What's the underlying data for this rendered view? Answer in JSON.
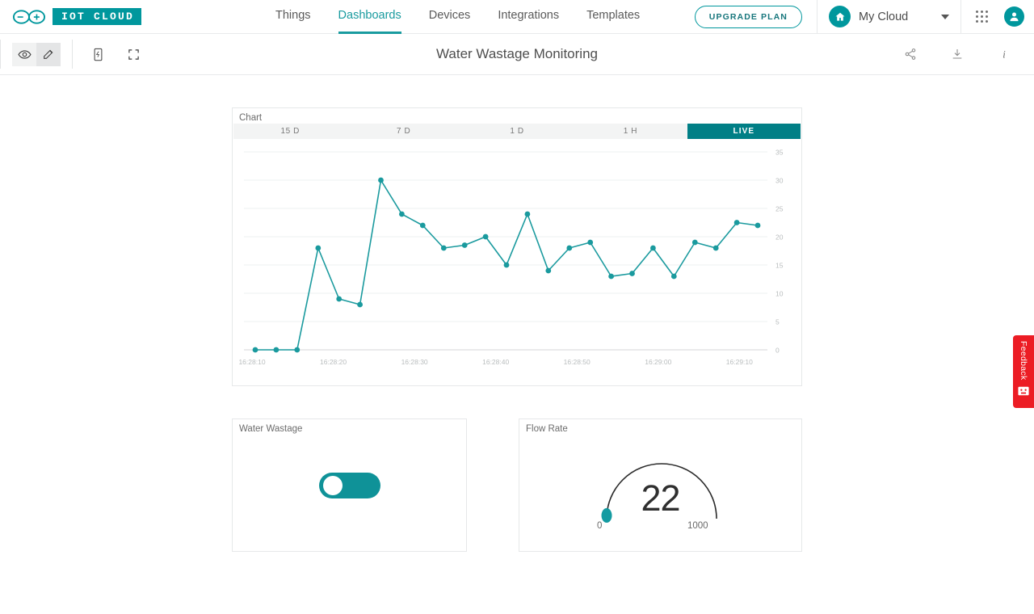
{
  "topnav": {
    "brand_label": "IOT CLOUD",
    "brand_icon": "arduino-infinity-logo",
    "tabs": [
      {
        "label": "Things",
        "active": false
      },
      {
        "label": "Dashboards",
        "active": true
      },
      {
        "label": "Devices",
        "active": false
      },
      {
        "label": "Integrations",
        "active": false
      },
      {
        "label": "Templates",
        "active": false
      }
    ],
    "upgrade_label": "UPGRADE PLAN",
    "cloud_name": "My Cloud",
    "cloud_icon": "home-icon",
    "caret_icon": "chevron-down-icon",
    "apps_icon": "apps-grid-icon",
    "avatar_icon": "account-avatar-icon"
  },
  "toolbar": {
    "view_icon": "eye-icon",
    "edit_icon": "pencil-edit-icon",
    "mobile_icon": "mobile-preview-icon",
    "fullscreen_icon": "fullscreen-icon",
    "title": "Water Wastage Monitoring",
    "share_icon": "share-icon",
    "download_icon": "download-icon",
    "info_icon": "info-icon"
  },
  "widgets": {
    "chart": {
      "title": "Chart",
      "ranges": [
        {
          "label": "15 D",
          "active": false
        },
        {
          "label": "7 D",
          "active": false
        },
        {
          "label": "1 D",
          "active": false
        },
        {
          "label": "1 H",
          "active": false
        },
        {
          "label": "LIVE",
          "active": true
        }
      ]
    },
    "toggle": {
      "title": "Water Wastage",
      "state": "on",
      "color": "#0f9298"
    },
    "gauge": {
      "title": "Flow Rate",
      "value": "22",
      "min": "0",
      "max": "1000",
      "color": "#149ba1"
    }
  },
  "feedback": {
    "label": "Feedback",
    "icon": "feedback-face-icon",
    "color": "#ec1c24"
  },
  "chart_data": {
    "type": "line",
    "title": "Chart",
    "xlabel": "",
    "ylabel": "",
    "ylim": [
      0,
      35
    ],
    "grid": true,
    "legend": false,
    "line_color": "#1a9a9e",
    "y_ticks": [
      35,
      30,
      25,
      20,
      15,
      10,
      5,
      0
    ],
    "x_ticks": [
      "16:28:10",
      "16:28:20",
      "16:28:30",
      "16:28:40",
      "16:28:50",
      "16:29:00",
      "16:29:10"
    ],
    "x": [
      "16:28:10",
      "16:28:12",
      "16:28:14",
      "16:28:16",
      "16:28:18",
      "16:28:20",
      "16:28:22",
      "16:28:24",
      "16:28:26",
      "16:28:28",
      "16:28:30",
      "16:28:32",
      "16:28:34",
      "16:28:36",
      "16:28:38",
      "16:28:40",
      "16:28:42",
      "16:28:44",
      "16:28:46",
      "16:28:48",
      "16:28:50",
      "16:28:52",
      "16:28:54",
      "16:28:56",
      "16:28:58",
      "16:29:00",
      "16:29:02",
      "16:29:04",
      "16:29:06",
      "16:29:08",
      "16:29:10",
      "16:29:12"
    ],
    "values": [
      0,
      0,
      0,
      18,
      9,
      8,
      30,
      24,
      22,
      18,
      18.5,
      20,
      15,
      24,
      14,
      18,
      19,
      13,
      13.5,
      18,
      13,
      19,
      18,
      22.5,
      22
    ]
  }
}
